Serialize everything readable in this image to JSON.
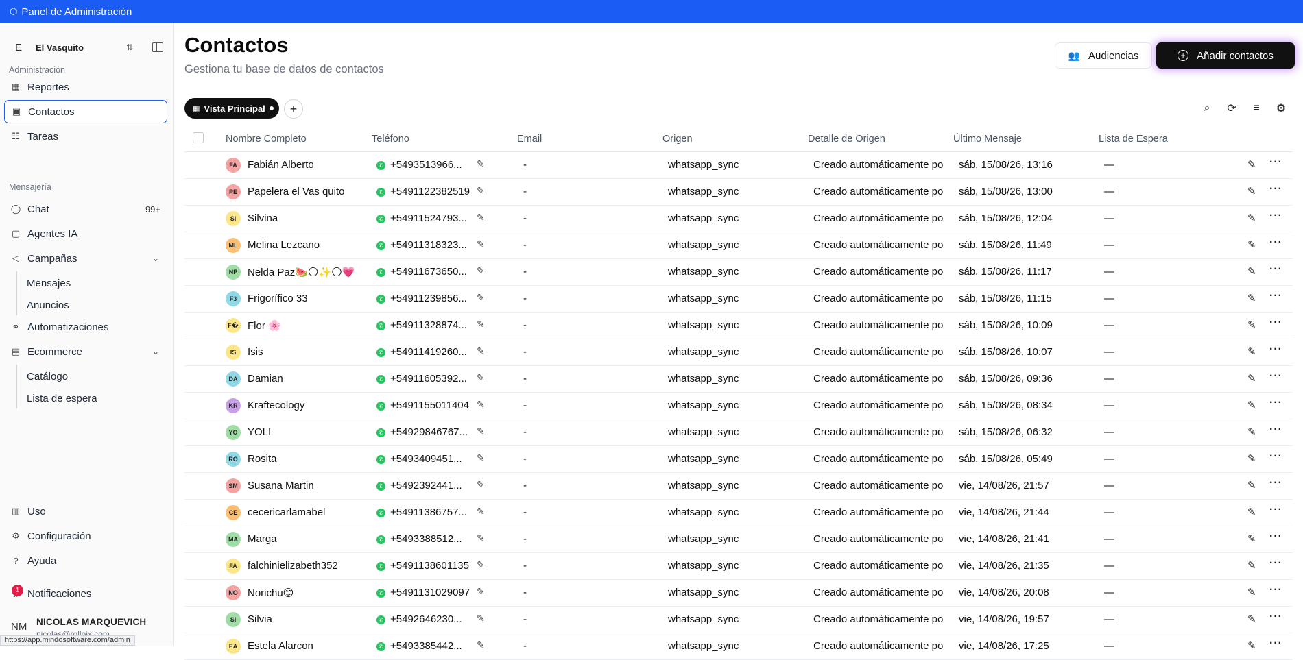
{
  "topbar": {
    "title": "Panel de Administración",
    "icon": "hexagon-icon"
  },
  "workspace": {
    "letter": "E",
    "name": "El Vasquito"
  },
  "sidebar": {
    "section_admin": "Administración",
    "section_msg": "Mensajería",
    "items": [
      {
        "label": "Reportes",
        "icon": "reports-icon"
      },
      {
        "label": "Contactos",
        "icon": "contacts-icon"
      },
      {
        "label": "Tareas",
        "icon": "tasks-icon"
      },
      {
        "label": "Chat",
        "icon": "chat-icon",
        "badge": "99+"
      },
      {
        "label": "Agentes IA",
        "icon": "bot-icon"
      },
      {
        "label": "Campañas",
        "icon": "megaphone-icon"
      },
      {
        "label": "Automatizaciones",
        "icon": "workflow-icon"
      },
      {
        "label": "Ecommerce",
        "icon": "store-icon"
      },
      {
        "label": "Uso",
        "icon": "chart-icon"
      },
      {
        "label": "Configuración",
        "icon": "gear-icon"
      },
      {
        "label": "Ayuda",
        "icon": "help-icon"
      },
      {
        "label": "Notificaciones",
        "icon": "bell-icon",
        "badge": "1"
      }
    ],
    "campaigns_sub": [
      "Mensajes",
      "Anuncios"
    ],
    "ecommerce_sub": [
      "Catálogo",
      "Lista de espera"
    ]
  },
  "user": {
    "initials": "NM",
    "name": "NICOLAS MARQUEVICH",
    "email": "nicolas@rollpix.com"
  },
  "status_url": "https://app.mindosoftware.com/admin",
  "header": {
    "title": "Contactos",
    "subtitle": "Gestiona tu base de datos de contactos",
    "audiences_label": "Audiencias",
    "add_label": "Añadir contactos"
  },
  "view": {
    "label": "Vista Principal"
  },
  "table": {
    "columns": [
      "Nombre Completo",
      "Teléfono",
      "Email",
      "Origen",
      "Detalle de Origen",
      "Último Mensaje",
      "Lista de Espera"
    ],
    "rows": [
      {
        "initials": "FA",
        "color": "#f4a3a3",
        "name": "Fabián Alberto",
        "phone": "+5493513966...",
        "email": "-",
        "origin": "whatsapp_sync",
        "detail": "Creado automáticamente po",
        "last": "sáb, 15/08/26, 13:16",
        "wait": "—"
      },
      {
        "initials": "PE",
        "color": "#f4a3a3",
        "name": "Papelera el Vas quito",
        "phone": "+5491122382519",
        "email": "-",
        "origin": "whatsapp_sync",
        "detail": "Creado automáticamente po",
        "last": "sáb, 15/08/26, 13:00",
        "wait": "—"
      },
      {
        "initials": "SI",
        "color": "#fbe78a",
        "name": "Silvina",
        "phone": "+54911524793...",
        "email": "-",
        "origin": "whatsapp_sync",
        "detail": "Creado automáticamente po",
        "last": "sáb, 15/08/26, 12:04",
        "wait": "—"
      },
      {
        "initials": "ML",
        "color": "#fbbf73",
        "name": "Melina Lezcano",
        "phone": "+54911318323...",
        "email": "-",
        "origin": "whatsapp_sync",
        "detail": "Creado automáticamente po",
        "last": "sáb, 15/08/26, 11:49",
        "wait": "—"
      },
      {
        "initials": "NP",
        "color": "#9fdca6",
        "name": "Nelda Paz🍉🌕✨🌕💗",
        "phone": "+54911673650...",
        "email": "-",
        "origin": "whatsapp_sync",
        "detail": "Creado automáticamente po",
        "last": "sáb, 15/08/26, 11:17",
        "wait": "—"
      },
      {
        "initials": "F3",
        "color": "#8fd8e6",
        "name": "Frigorífico 33",
        "phone": "+54911239856...",
        "email": "-",
        "origin": "whatsapp_sync",
        "detail": "Creado automáticamente po",
        "last": "sáb, 15/08/26, 11:15",
        "wait": "—"
      },
      {
        "initials": "F�",
        "color": "#fbe78a",
        "name": "Flor 🌸",
        "phone": "+54911328874...",
        "email": "-",
        "origin": "whatsapp_sync",
        "detail": "Creado automáticamente po",
        "last": "sáb, 15/08/26, 10:09",
        "wait": "—"
      },
      {
        "initials": "IS",
        "color": "#fbe78a",
        "name": "Isis",
        "phone": "+54911419260...",
        "email": "-",
        "origin": "whatsapp_sync",
        "detail": "Creado automáticamente po",
        "last": "sáb, 15/08/26, 10:07",
        "wait": "—"
      },
      {
        "initials": "DA",
        "color": "#8fd8e6",
        "name": "Damian",
        "phone": "+54911605392...",
        "email": "-",
        "origin": "whatsapp_sync",
        "detail": "Creado automáticamente po",
        "last": "sáb, 15/08/26, 09:36",
        "wait": "—"
      },
      {
        "initials": "KR",
        "color": "#c9a0e8",
        "name": "Kraftecology",
        "phone": "+5491155011404",
        "email": "-",
        "origin": "whatsapp_sync",
        "detail": "Creado automáticamente po",
        "last": "sáb, 15/08/26, 08:34",
        "wait": "—"
      },
      {
        "initials": "YO",
        "color": "#9fdca6",
        "name": "YOLI",
        "phone": "+54929846767...",
        "email": "-",
        "origin": "whatsapp_sync",
        "detail": "Creado automáticamente po",
        "last": "sáb, 15/08/26, 06:32",
        "wait": "—"
      },
      {
        "initials": "RO",
        "color": "#8fd8e6",
        "name": "Rosita",
        "phone": "+5493409451...",
        "email": "-",
        "origin": "whatsapp_sync",
        "detail": "Creado automáticamente po",
        "last": "sáb, 15/08/26, 05:49",
        "wait": "—"
      },
      {
        "initials": "SM",
        "color": "#f4a3a3",
        "name": "Susana Martin",
        "phone": "+5492392441...",
        "email": "-",
        "origin": "whatsapp_sync",
        "detail": "Creado automáticamente po",
        "last": "vie, 14/08/26, 21:57",
        "wait": "—"
      },
      {
        "initials": "CE",
        "color": "#fbbf73",
        "name": "cecericarlamabel",
        "phone": "+54911386757...",
        "email": "-",
        "origin": "whatsapp_sync",
        "detail": "Creado automáticamente po",
        "last": "vie, 14/08/26, 21:44",
        "wait": "—"
      },
      {
        "initials": "MA",
        "color": "#9fdca6",
        "name": "Marga",
        "phone": "+5493388512...",
        "email": "-",
        "origin": "whatsapp_sync",
        "detail": "Creado automáticamente po",
        "last": "vie, 14/08/26, 21:41",
        "wait": "—"
      },
      {
        "initials": "FA",
        "color": "#fbe78a",
        "name": "falchinielizabeth352",
        "phone": "+5491138601135",
        "email": "-",
        "origin": "whatsapp_sync",
        "detail": "Creado automáticamente po",
        "last": "vie, 14/08/26, 21:35",
        "wait": "—"
      },
      {
        "initials": "NO",
        "color": "#f4a3a3",
        "name": "Norichu😊",
        "phone": "+5491131029097",
        "email": "-",
        "origin": "whatsapp_sync",
        "detail": "Creado automáticamente po",
        "last": "vie, 14/08/26, 20:08",
        "wait": "—"
      },
      {
        "initials": "SI",
        "color": "#9fdca6",
        "name": "Silvia",
        "phone": "+5492646230...",
        "email": "-",
        "origin": "whatsapp_sync",
        "detail": "Creado automáticamente po",
        "last": "vie, 14/08/26, 19:57",
        "wait": "—"
      },
      {
        "initials": "EA",
        "color": "#fbe78a",
        "name": "Estela Alarcon",
        "phone": "+5493385442...",
        "email": "-",
        "origin": "whatsapp_sync",
        "detail": "Creado automáticamente po",
        "last": "vie, 14/08/26, 17:25",
        "wait": "—"
      }
    ]
  }
}
